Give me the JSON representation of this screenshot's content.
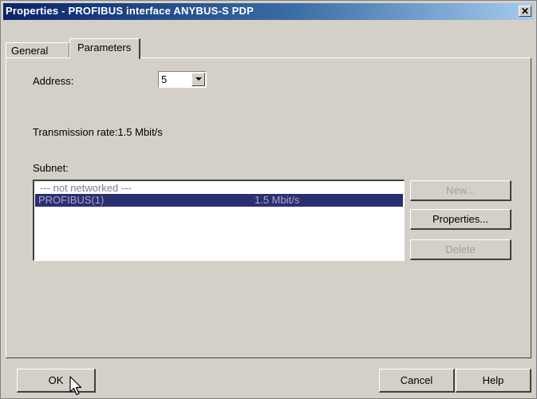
{
  "window": {
    "title": "Properties - PROFIBUS interface  ANYBUS-S PDP",
    "close_glyph": "✕"
  },
  "tabs": [
    {
      "label": "General",
      "active": false
    },
    {
      "label": "Parameters",
      "active": true
    }
  ],
  "parameters": {
    "address_label": "Address:",
    "address_value": "5",
    "transmission_rate": "Transmission rate:1.5 Mbit/s",
    "subnet_label": "Subnet:",
    "subnets": [
      {
        "name": "--- not networked ---",
        "rate": "",
        "selected": false
      },
      {
        "name": "PROFIBUS(1)",
        "rate": "1.5 Mbit/s",
        "selected": true
      }
    ],
    "buttons": {
      "new": "New...",
      "properties": "Properties...",
      "delete": "Delete"
    }
  },
  "footer": {
    "ok": "OK",
    "cancel": "Cancel",
    "help": "Help"
  },
  "colors": {
    "title_gradient_start": "#0a246a",
    "title_gradient_end": "#a6caf0",
    "selection": "#2b2f70",
    "face": "#d4d0c8"
  },
  "icons": {
    "close": "close-icon",
    "dropdown": "chevron-down-icon",
    "cursor": "mouse-pointer-icon"
  }
}
